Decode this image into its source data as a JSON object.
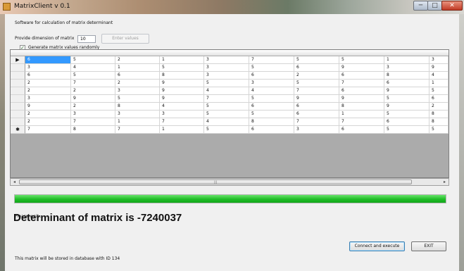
{
  "window": {
    "title": "MatrixClient v 0.1",
    "min_glyph": "─",
    "max_glyph": "□",
    "close_glyph": "✕"
  },
  "header": {
    "description": "Software for calculation of matrix determinant",
    "dimension_label": "Provide dimension of matrix",
    "dimension_value": "10",
    "enter_values_label": "Enter values",
    "random_label": "Generate matrix values randomly",
    "random_checked": true,
    "check_glyph": "✓"
  },
  "grid": {
    "current_row_glyph": "▶",
    "new_row_glyph": "✱",
    "rows": [
      [
        "6",
        "5",
        "2",
        "1",
        "3",
        "7",
        "5",
        "5",
        "1",
        "3"
      ],
      [
        "3",
        "4",
        "1",
        "5",
        "3",
        "5",
        "6",
        "9",
        "3",
        "9"
      ],
      [
        "6",
        "5",
        "6",
        "8",
        "3",
        "6",
        "2",
        "6",
        "8",
        "4"
      ],
      [
        "2",
        "7",
        "2",
        "9",
        "5",
        "3",
        "5",
        "7",
        "6",
        "1"
      ],
      [
        "2",
        "2",
        "3",
        "9",
        "4",
        "4",
        "7",
        "6",
        "9",
        "5"
      ],
      [
        "3",
        "9",
        "5",
        "9",
        "7",
        "5",
        "9",
        "9",
        "5",
        "6"
      ],
      [
        "9",
        "2",
        "8",
        "4",
        "5",
        "6",
        "6",
        "8",
        "9",
        "2"
      ],
      [
        "2",
        "3",
        "3",
        "3",
        "5",
        "5",
        "6",
        "1",
        "5",
        "8"
      ],
      [
        "2",
        "7",
        "1",
        "7",
        "4",
        "8",
        "7",
        "7",
        "6",
        "8"
      ],
      [
        "7",
        "8",
        "7",
        "1",
        "5",
        "6",
        "3",
        "6",
        "5",
        "5"
      ]
    ],
    "scroll_left": "◂",
    "scroll_right": "▸",
    "scroll_grip": "|||"
  },
  "status": {
    "text": "Please wait...",
    "progress": 1.0
  },
  "result": {
    "text": "Determinant of matrix is -7240037"
  },
  "footer": {
    "note": "This matrix will be stored in database with ID 134",
    "connect_label": "Connect and execute",
    "exit_label": "EXIT"
  },
  "colors": {
    "selection": "#3399ff",
    "progress_green": "#1fbd27"
  }
}
